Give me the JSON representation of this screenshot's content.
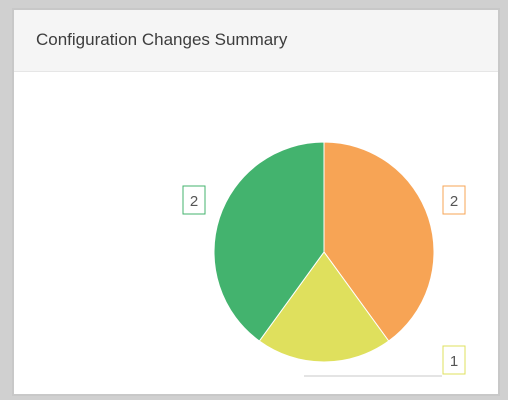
{
  "panel": {
    "title": "Configuration Changes Summary"
  },
  "chart_data": {
    "type": "pie",
    "title": "",
    "slices": [
      {
        "value": 2,
        "label": "2",
        "color": "#f7a455"
      },
      {
        "value": 1,
        "label": "1",
        "color": "#dfe05d"
      },
      {
        "value": 2,
        "label": "2",
        "color": "#43b36e"
      }
    ],
    "legend": false
  }
}
